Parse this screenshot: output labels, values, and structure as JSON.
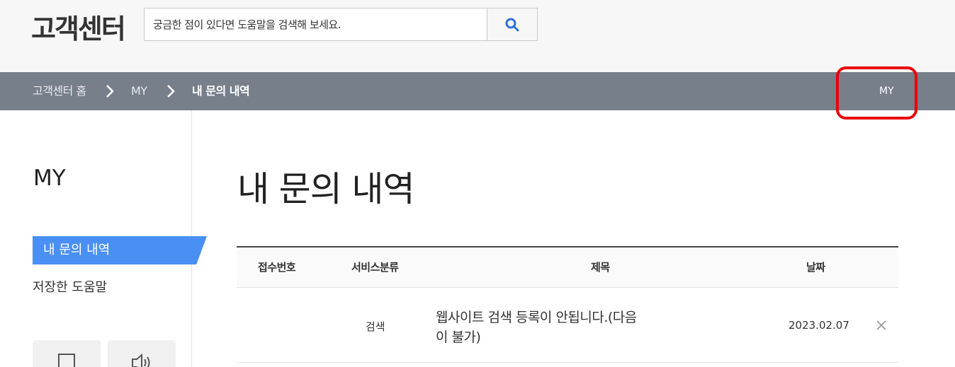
{
  "header": {
    "logo": "고객센터",
    "search_placeholder": "궁금한 점이 있다면 도움말을 검색해 보세요.",
    "search_icon": "search-icon"
  },
  "breadcrumb": {
    "home": "고객센터 홈",
    "my": "MY",
    "current": "내 문의 내역",
    "right_link": "MY"
  },
  "sidebar": {
    "title": "MY",
    "items": [
      {
        "label": "내 문의 내역",
        "active": true
      },
      {
        "label": "저장한 도움말",
        "active": false
      }
    ]
  },
  "main": {
    "title": "내 문의 내역",
    "table": {
      "headers": [
        "접수번호",
        "서비스분류",
        "제목",
        "날짜"
      ],
      "rows": [
        {
          "id": "",
          "service": "검색",
          "title": "웹사이트 검색 등록이 안됩니다.(다음이 불가)",
          "date": "2023.02.07"
        }
      ]
    }
  },
  "colors": {
    "accent": "#4a90f4",
    "crumb_bar": "#777f8b",
    "highlight": "#e8000b"
  }
}
